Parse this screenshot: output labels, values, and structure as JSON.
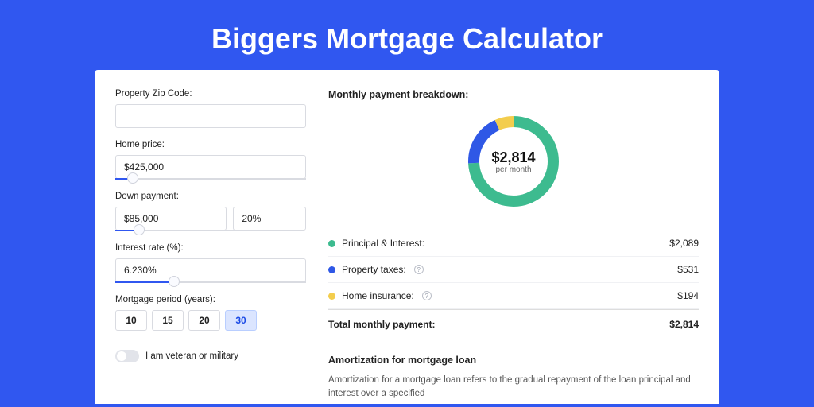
{
  "title": "Biggers Mortgage Calculator",
  "form": {
    "zip_label": "Property Zip Code:",
    "zip_value": "",
    "home_price_label": "Home price:",
    "home_price_value": "$425,000",
    "home_price_slider_pct": 9,
    "down_label": "Down payment:",
    "down_amount": "$85,000",
    "down_pct": "20%",
    "down_slider_pct": 20,
    "rate_label": "Interest rate (%):",
    "rate_value": "6.230%",
    "rate_slider_pct": 31,
    "period_label": "Mortgage period (years):",
    "periods": [
      "10",
      "15",
      "20",
      "30"
    ],
    "period_selected": "30",
    "veteran_label": "I am veteran or military"
  },
  "breakdown": {
    "title": "Monthly payment breakdown:",
    "center_value": "$2,814",
    "center_sub": "per month",
    "items": [
      {
        "key": "pi",
        "label": "Principal & Interest:",
        "value": "$2,089",
        "color": "#3dbb8f",
        "pct": 74.2,
        "info": false
      },
      {
        "key": "tax",
        "label": "Property taxes:",
        "value": "$531",
        "color": "#2f58e6",
        "pct": 18.9,
        "info": true
      },
      {
        "key": "ins",
        "label": "Home insurance:",
        "value": "$194",
        "color": "#f3cd4d",
        "pct": 6.9,
        "info": true
      }
    ],
    "total_label": "Total monthly payment:",
    "total_value": "$2,814"
  },
  "amort": {
    "title": "Amortization for mortgage loan",
    "text": "Amortization for a mortgage loan refers to the gradual repayment of the loan principal and interest over a specified"
  },
  "chart_data": {
    "type": "pie",
    "title": "Monthly payment breakdown",
    "series": [
      {
        "name": "Principal & Interest",
        "value": 2089,
        "color": "#3dbb8f"
      },
      {
        "name": "Property taxes",
        "value": 531,
        "color": "#2f58e6"
      },
      {
        "name": "Home insurance",
        "value": 194,
        "color": "#f3cd4d"
      }
    ],
    "total": 2814,
    "center_label": "$2,814 per month"
  }
}
